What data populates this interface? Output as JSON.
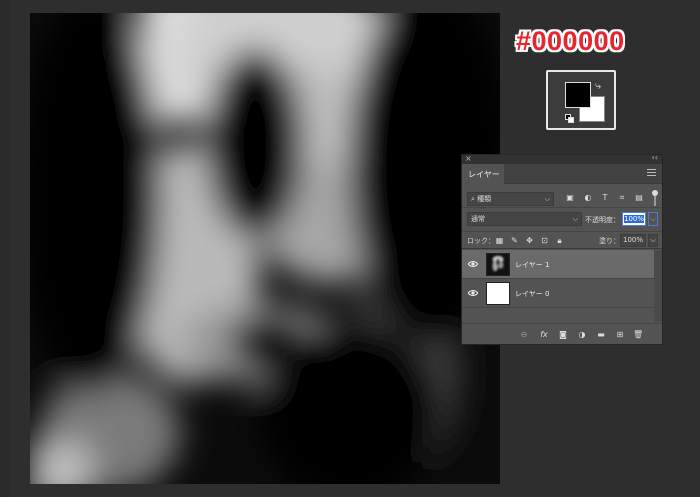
{
  "annotation": {
    "color_code": "#000000",
    "accent": "#e8242c"
  },
  "swatches": {
    "foreground": "#000000",
    "background": "#ffffff"
  },
  "layers_panel": {
    "tab_label": "レイヤー",
    "filter_label": "種類",
    "blend_mode": "通常",
    "opacity_label": "不透明度：",
    "opacity_value": "100%",
    "lock_label": "ロック：",
    "fill_label": "塗り：",
    "fill_value": "100%",
    "layers": [
      {
        "name": "レイヤー 1",
        "selected": true
      },
      {
        "name": "レイヤー 0",
        "selected": false
      }
    ]
  }
}
